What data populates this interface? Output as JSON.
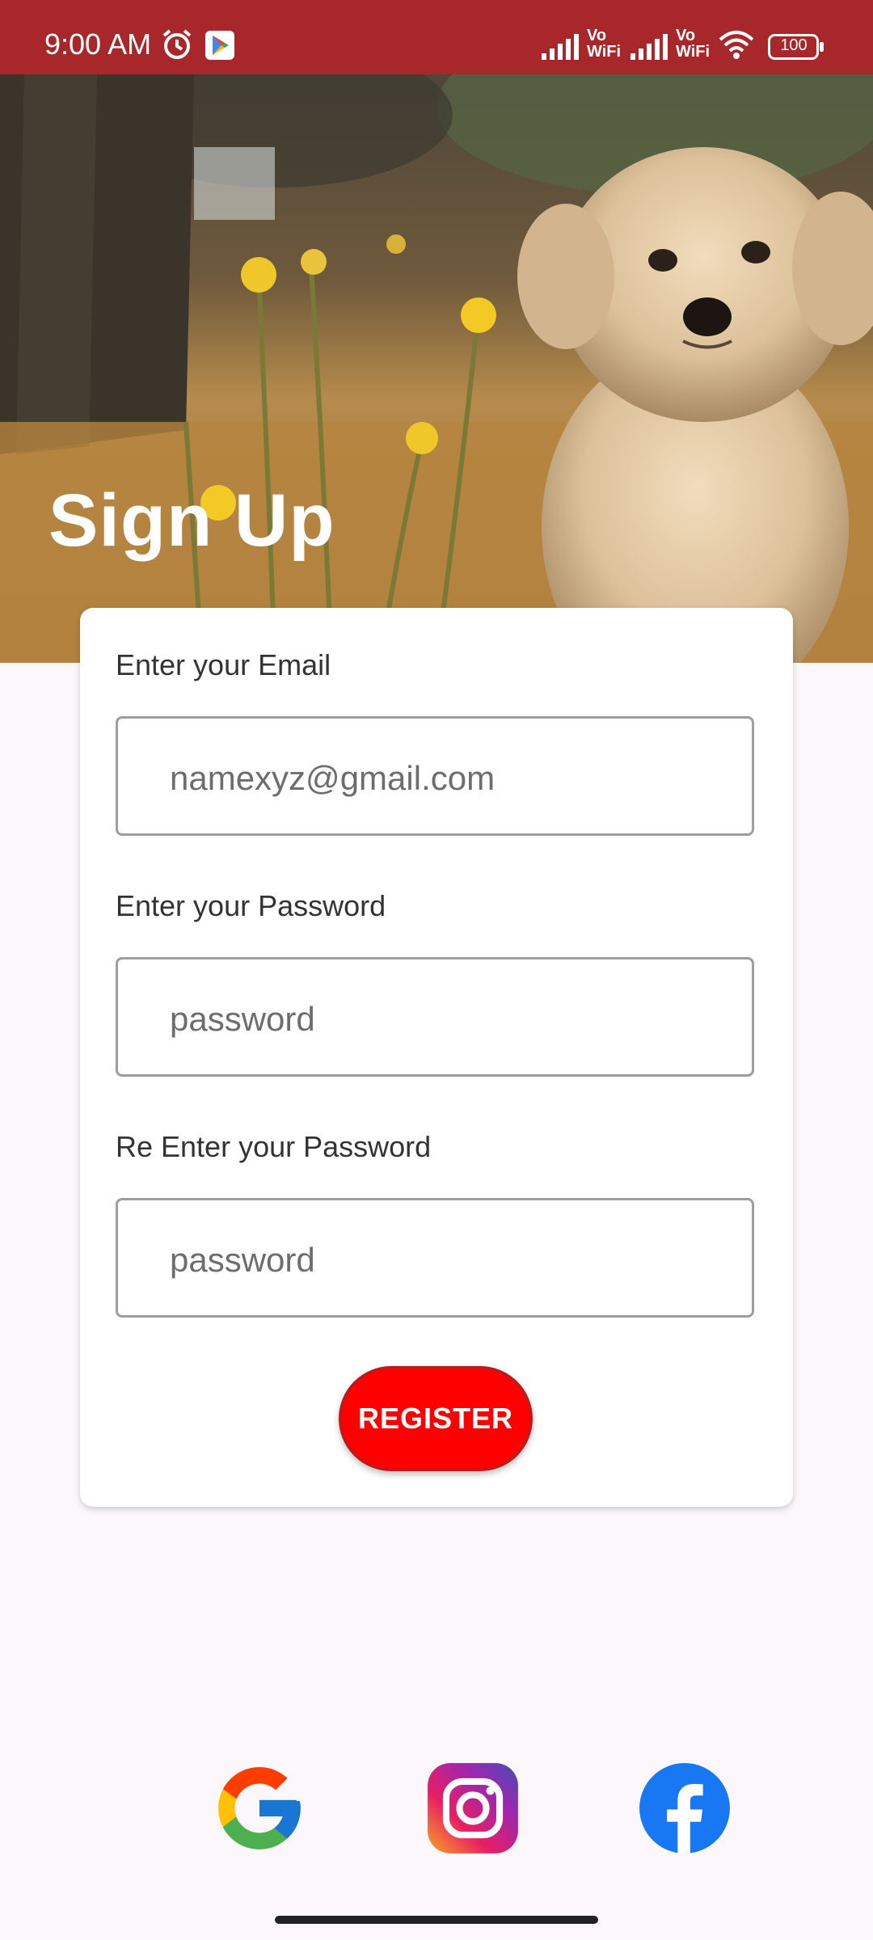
{
  "status_bar": {
    "time": "9:00 AM",
    "network_1": "Vo WiFi",
    "network_2": "Vo WiFi",
    "battery": "100",
    "background": "#a8272b"
  },
  "hero": {
    "title": "Sign Up"
  },
  "form": {
    "email_label": "Enter your Email",
    "email_placeholder": "namexyz@gmail.com",
    "password_label": "Enter your Password",
    "password_placeholder": "password",
    "reenter_label": "Re Enter your Password",
    "reenter_placeholder": "password",
    "register_label": "REGISTER",
    "register_color": "#ff0000"
  },
  "social": {
    "icons": [
      "google-icon",
      "instagram-icon",
      "facebook-icon"
    ]
  }
}
